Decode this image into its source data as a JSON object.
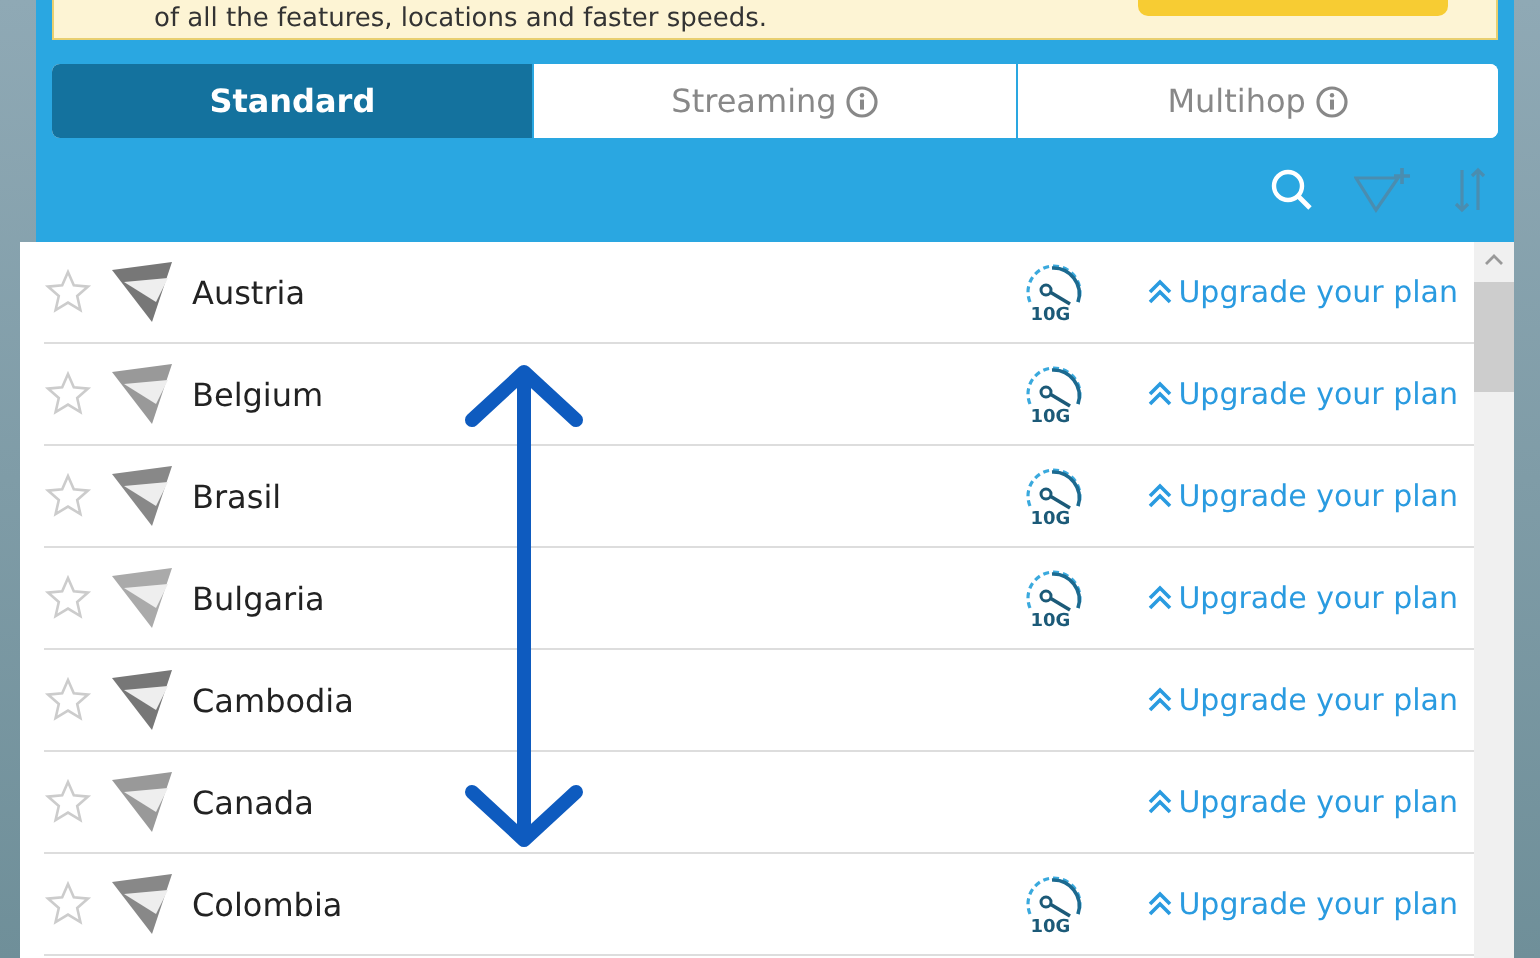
{
  "banner": {
    "text": "of all the features, locations and faster speeds."
  },
  "tabs": [
    {
      "label": "Standard",
      "selected": true,
      "info": false
    },
    {
      "label": "Streaming",
      "selected": false,
      "info": true
    },
    {
      "label": "Multihop",
      "selected": false,
      "info": true
    }
  ],
  "servers": [
    {
      "name": "Austria",
      "favorite": false,
      "speed_badge": "10G",
      "link": "Upgrade your plan"
    },
    {
      "name": "Belgium",
      "favorite": false,
      "speed_badge": "10G",
      "link": "Upgrade your plan"
    },
    {
      "name": "Brasil",
      "favorite": false,
      "speed_badge": "10G",
      "link": "Upgrade your plan"
    },
    {
      "name": "Bulgaria",
      "favorite": false,
      "speed_badge": "10G",
      "link": "Upgrade your plan"
    },
    {
      "name": "Cambodia",
      "favorite": false,
      "link": "Upgrade your plan"
    },
    {
      "name": "Canada",
      "favorite": false,
      "link": "Upgrade your plan"
    },
    {
      "name": "Colombia",
      "favorite": false,
      "speed_badge": "10G",
      "link": "Upgrade your plan"
    }
  ]
}
